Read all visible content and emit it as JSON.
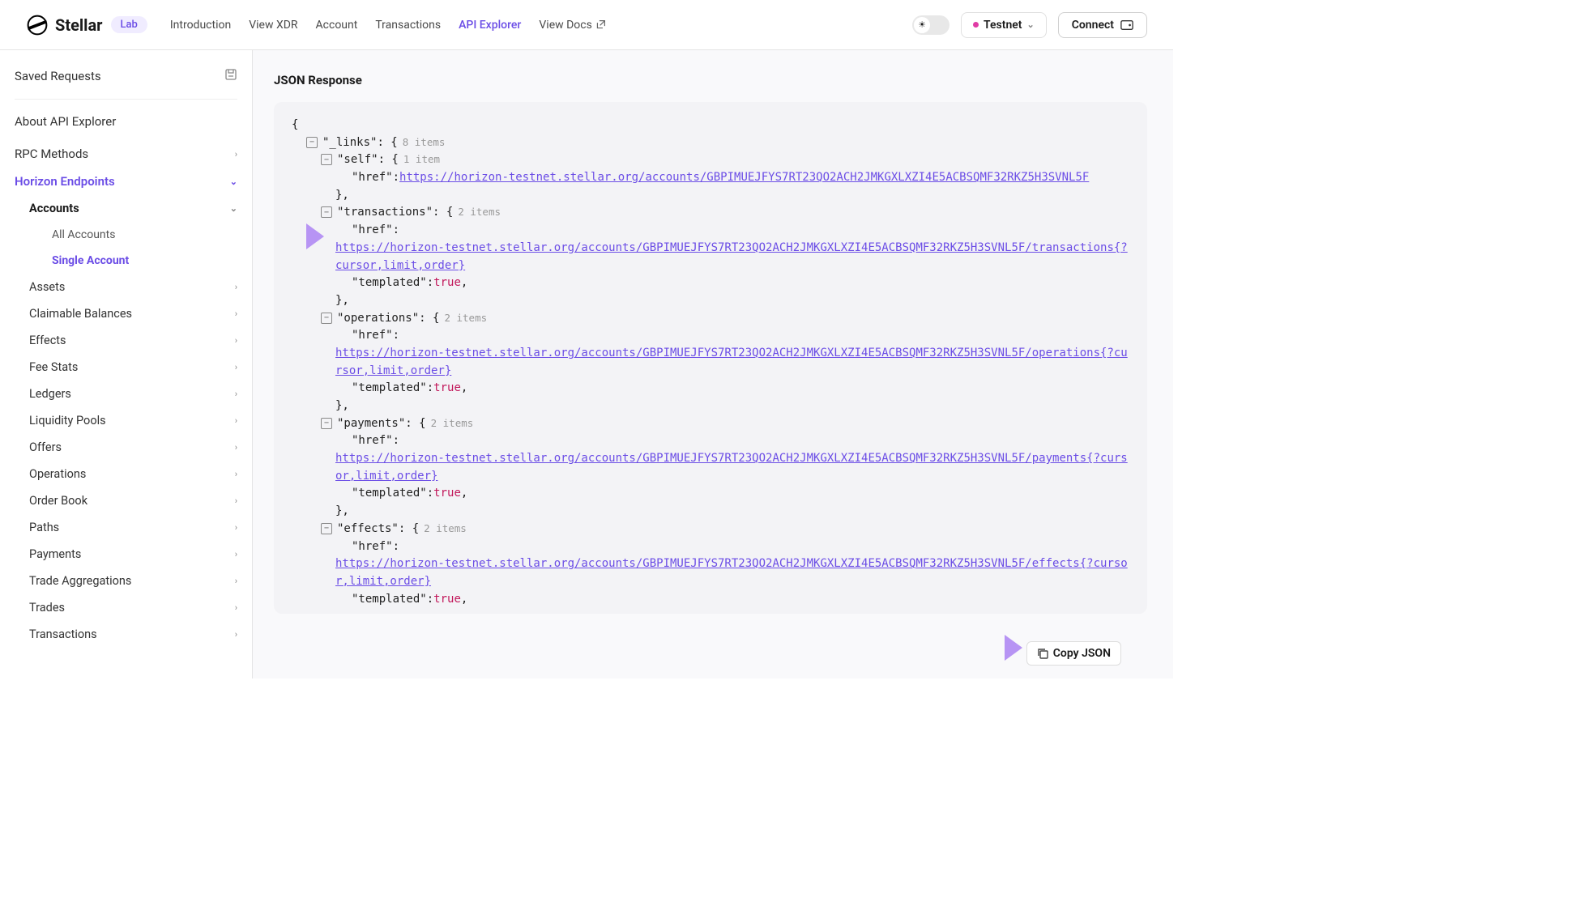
{
  "brand": "Stellar",
  "lab_badge": "Lab",
  "nav": {
    "intro": "Introduction",
    "view_xdr": "View XDR",
    "account": "Account",
    "transactions": "Transactions",
    "api_explorer": "API Explorer",
    "view_docs": "View Docs"
  },
  "network": {
    "label": "Testnet"
  },
  "connect": "Connect",
  "sidebar": {
    "saved": "Saved Requests",
    "about": "About API Explorer",
    "rpc": "RPC Methods",
    "horizon": "Horizon Endpoints",
    "accounts": "Accounts",
    "all_accounts": "All Accounts",
    "single_account": "Single Account",
    "groups": [
      "Assets",
      "Claimable Balances",
      "Effects",
      "Fee Stats",
      "Ledgers",
      "Liquidity Pools",
      "Offers",
      "Operations",
      "Order Book",
      "Paths",
      "Payments",
      "Trade Aggregations",
      "Trades",
      "Transactions"
    ]
  },
  "panel_title": "JSON Response",
  "copy_json": "Copy JSON",
  "json": {
    "links_key": "\"_links\"",
    "links_count": "8 items",
    "self_key": "\"self\"",
    "self_count": "1 item",
    "href_key": "\"href\"",
    "templated_key": "\"templated\"",
    "true": "true",
    "self_href": "https://horizon-testnet.stellar.org/accounts/GBPIMUEJFYS7RT23QO2ACH2JMKGXLXZI4E5ACBSQMF32RKZ5H3SVNL5F",
    "tx_key": "\"transactions\"",
    "tx_count": "2 items",
    "tx_href": "https://horizon-testnet.stellar.org/accounts/GBPIMUEJFYS7RT23QO2ACH2JMKGXLXZI4E5ACBSQMF32RKZ5H3SVNL5F/transactions{?cursor,limit,order}",
    "ops_key": "\"operations\"",
    "ops_count": "2 items",
    "ops_href": "https://horizon-testnet.stellar.org/accounts/GBPIMUEJFYS7RT23QO2ACH2JMKGXLXZI4E5ACBSQMF32RKZ5H3SVNL5F/operations{?cursor,limit,order}",
    "pay_key": "\"payments\"",
    "pay_count": "2 items",
    "pay_href": "https://horizon-testnet.stellar.org/accounts/GBPIMUEJFYS7RT23QO2ACH2JMKGXLXZI4E5ACBSQMF32RKZ5H3SVNL5F/payments{?cursor,limit,order}",
    "eff_key": "\"effects\"",
    "eff_count": "2 items",
    "eff_href": "https://horizon-testnet.stellar.org/accounts/GBPIMUEJFYS7RT23QO2ACH2JMKGXLXZI4E5ACBSQMF32RKZ5H3SVNL5F/effects{?cursor,limit,order}"
  }
}
